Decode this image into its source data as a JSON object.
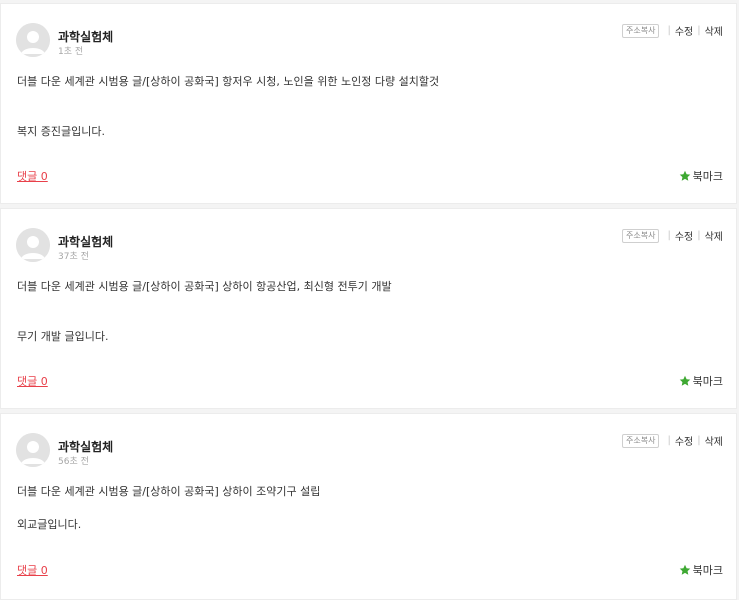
{
  "posts": [
    {
      "author": "과학실험체",
      "time": "1초 전",
      "title": "더블 다운 세계관 시범용 글/[상하이 공화국] 항저우 시청, 노인을 위한 노인정 다량 설치할것",
      "body": "복지 증진글입니다.",
      "comments": "댓글 0",
      "bookmark": "북마크",
      "copy": "주소복사",
      "edit": "수정",
      "delete": "삭제"
    },
    {
      "author": "과학실험체",
      "time": "37초 전",
      "title": "더블 다운 세계관 시범용 글/[상하이 공화국] 상하이 항공산업, 최신형 전투기 개발",
      "body": "무기 개발 글입니다.",
      "comments": "댓글 0",
      "bookmark": "북마크",
      "copy": "주소복사",
      "edit": "수정",
      "delete": "삭제"
    },
    {
      "author": "과학실험체",
      "time": "56초 전",
      "title": "더블 다운 세계관 시범용 글/[상하이 공화국] 상하이 조약기구 설립",
      "body": "외교글입니다.",
      "comments": "댓글 0",
      "bookmark": "북마크",
      "copy": "주소복사",
      "edit": "수정",
      "delete": "삭제"
    }
  ],
  "colors": {
    "comment_link": "#e8404a",
    "bookmark_star": "#3ea832",
    "avatar_bg": "#e2e2e2"
  }
}
